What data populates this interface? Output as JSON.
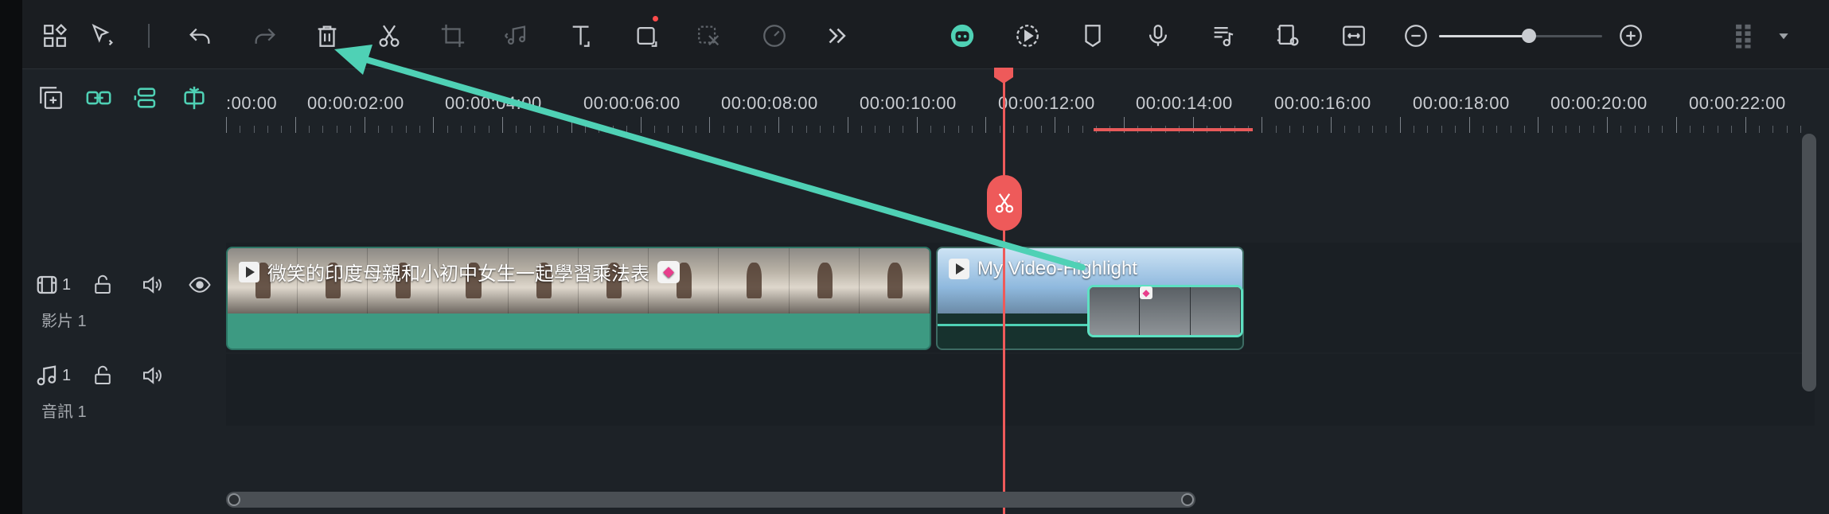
{
  "toolbar": {
    "icons": [
      "apps-icon",
      "select-tool-icon",
      "undo-icon",
      "redo-icon",
      "delete-icon",
      "cut-icon",
      "crop-icon",
      "audio-icon",
      "text-icon",
      "shape-icon",
      "mask-icon",
      "speed-icon",
      "more-icon"
    ],
    "right_icons": [
      "ai-assistant-icon",
      "playback-icon",
      "marker-icon",
      "microphone-icon",
      "music-list-icon",
      "preview-icon",
      "fit-icon",
      "zoom-out-icon",
      "zoom-in-icon",
      "layout-icon",
      "dropdown-icon"
    ],
    "zoom_level": 0.55
  },
  "ruler": {
    "labels": [
      ":00:00",
      "00:00:02:00",
      "00:00:04:00",
      "00:00:06:00",
      "00:00:08:00",
      "00:00:10:00",
      "00:00:12:00",
      "00:00:14:00",
      "00:00:16:00",
      "00:00:18:00",
      "00:00:20:00",
      "00:00:22:00"
    ]
  },
  "tracks": {
    "video": {
      "number": "1",
      "name": "影片 1"
    },
    "audio": {
      "number": "1",
      "name": "音訊 1"
    }
  },
  "clips": {
    "clip1_title": "微笑的印度母親和小初中女生一起學習乘法表",
    "clip2_title": "My Video-Highlight"
  },
  "colors": {
    "accent": "#4fd1b5",
    "playhead": "#ee5a5a",
    "annotation_arrow": "#4fd1b5"
  }
}
